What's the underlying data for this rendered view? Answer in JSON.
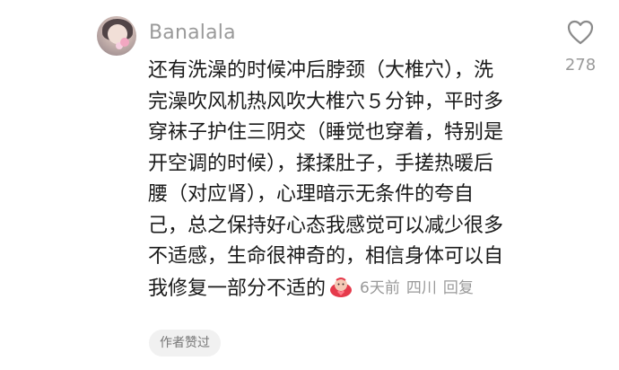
{
  "comment": {
    "username": "Banalala",
    "lines": [
      "还有洗澡的时候冲后脖颈（大椎穴），洗",
      "完澡吹风机热风吹大椎穴５分钟，平时多",
      "穿袜子护住三阴交（睡觉也穿着，特别是",
      "开空调的时候），揉揉肚子，手搓热暖后",
      "腰（对应肾），心理暗示无条件的夸自",
      "己，总之保持好心态我感觉可以减少很多",
      "不适感，生命很神奇的，相信身体可以自",
      "我修复一部分不适的"
    ],
    "emoji": "heart-hug-emoji",
    "time": "6天前",
    "location": "四川",
    "reply_label": "回复",
    "like_count": "278",
    "author_liked_badge": "作者赞过"
  },
  "colors": {
    "text": "#1a1a1a",
    "meta": "#9a9a9a",
    "badge_bg": "#f1f1f1"
  }
}
